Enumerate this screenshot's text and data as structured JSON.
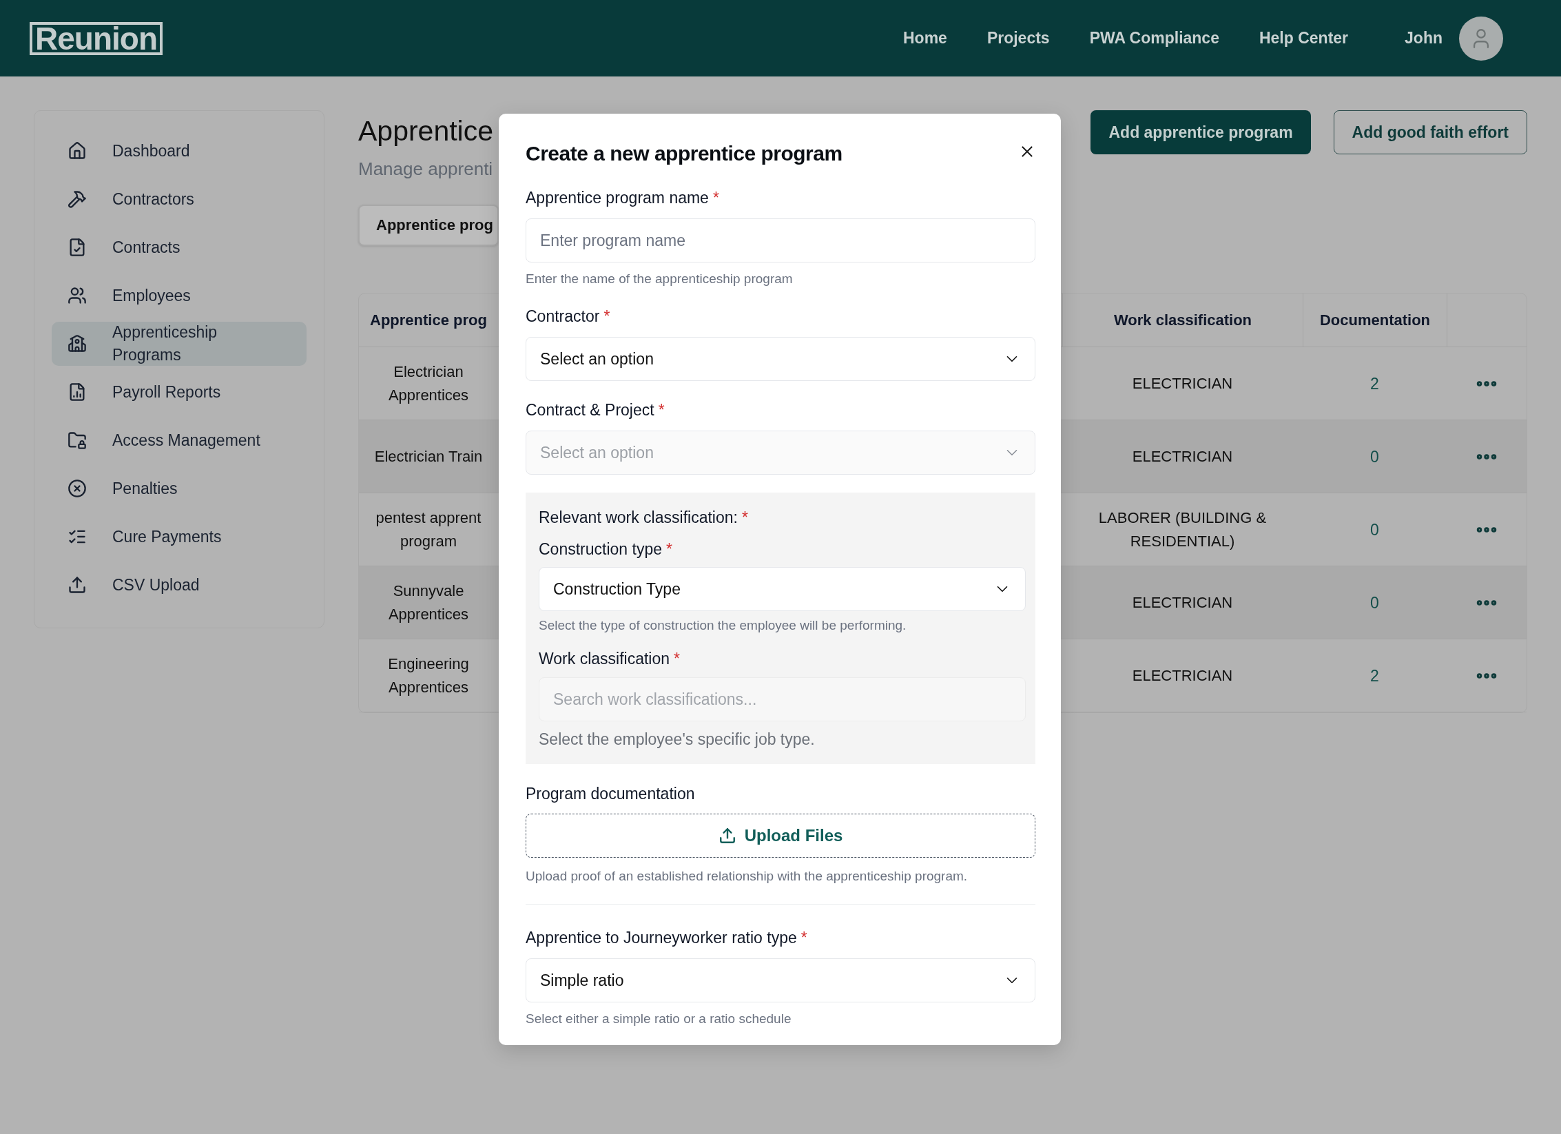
{
  "header": {
    "logo": "Reunion",
    "nav": [
      {
        "label": "Home"
      },
      {
        "label": "Projects"
      },
      {
        "label": "PWA Compliance"
      },
      {
        "label": "Help Center"
      }
    ],
    "user": "John"
  },
  "sidebar": {
    "items": [
      {
        "label": "Dashboard",
        "selected": false
      },
      {
        "label": "Contractors",
        "selected": false
      },
      {
        "label": "Contracts",
        "selected": false
      },
      {
        "label": "Employees",
        "selected": false
      },
      {
        "label": "Apprenticeship Programs",
        "selected": true
      },
      {
        "label": "Payroll Reports",
        "selected": false
      },
      {
        "label": "Access Management",
        "selected": false
      },
      {
        "label": "Penalties",
        "selected": false
      },
      {
        "label": "Cure Payments",
        "selected": false
      },
      {
        "label": "CSV Upload",
        "selected": false
      }
    ]
  },
  "page": {
    "title": "Apprentice",
    "subtitle": "Manage apprenti",
    "buttons": [
      {
        "label": "Add apprentice program",
        "kind": "primary"
      },
      {
        "label": "Add good faith effort",
        "kind": "outline"
      }
    ],
    "tabs": [
      {
        "label": "Apprentice prog",
        "selected": true
      }
    ]
  },
  "table": {
    "columns": [
      "Apprentice prog",
      "Work classification",
      "Documentation"
    ],
    "rows": [
      {
        "column_1": "Electrician Apprentices",
        "work_classification": "ELECTRICIAN",
        "documentation": "2"
      },
      {
        "column_1": "Electrician Train",
        "work_classification": "ELECTRICIAN",
        "documentation": "0"
      },
      {
        "column_1": "pentest apprent program",
        "work_classification": "LABORER (BUILDING & RESIDENTIAL)",
        "documentation": "0"
      },
      {
        "column_1": "Sunnyvale Apprentices",
        "work_classification": "ELECTRICIAN",
        "documentation": "0"
      },
      {
        "column_1": "Engineering Apprentices",
        "work_classification": "ELECTRICIAN",
        "documentation": "2"
      }
    ]
  },
  "modal": {
    "title": "Create a new apprentice program",
    "fields": [
      {
        "kind": "input",
        "label": "Apprentice program name",
        "required_mark": "*",
        "placeholder": "Enter program name",
        "helper": "Enter the name of the apprenticeship program"
      },
      {
        "kind": "select",
        "label": "Contractor",
        "required_mark": "*",
        "value": "Select an option",
        "disabled": false
      },
      {
        "kind": "select",
        "label": "Contract & Project",
        "required_mark": "*",
        "placeholder": "Select an option",
        "disabled": true
      },
      {
        "kind": "group",
        "label": "Relevant work classification:",
        "required_mark": "*",
        "fields": [
          {
            "kind": "select",
            "label": "Construction type",
            "required_mark": "*",
            "value": "Construction Type",
            "disabled": false,
            "helper": "Select the type of construction the employee will be performing."
          },
          {
            "kind": "search",
            "label": "Work classification",
            "required_mark": "*",
            "placeholder": "Search work classifications...",
            "disabled": true,
            "helper": "Select the employee's specific job type."
          }
        ]
      },
      {
        "kind": "upload",
        "label": "Program documentation",
        "button": "Upload Files",
        "helper": "Upload proof of an established relationship with the apprenticeship program."
      },
      {
        "kind": "divider"
      },
      {
        "kind": "select",
        "label": "Apprentice to Journeyworker ratio type",
        "required_mark": "*",
        "value": "Simple ratio",
        "disabled": false,
        "helper": "Select either a simple ratio or a ratio schedule"
      }
    ]
  }
}
